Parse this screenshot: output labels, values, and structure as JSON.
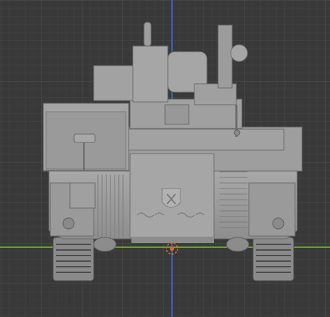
{
  "viewport": {
    "background_color": "#393939",
    "grid_major_color": "#454545",
    "grid_minor_color": "#3f3f3f",
    "axis_x_color": "#6e9f2b",
    "axis_y_color": "#3b63b0"
  },
  "scene": {
    "object": "armored-vehicle-front-view",
    "mesh_color": "#9c9c9c",
    "mesh_shadow_color": "#7a7a7a",
    "mesh_highlight_color": "#b4b4b4",
    "origin_marker_color": "#e06a2c",
    "emblem": "shield-emblem"
  }
}
